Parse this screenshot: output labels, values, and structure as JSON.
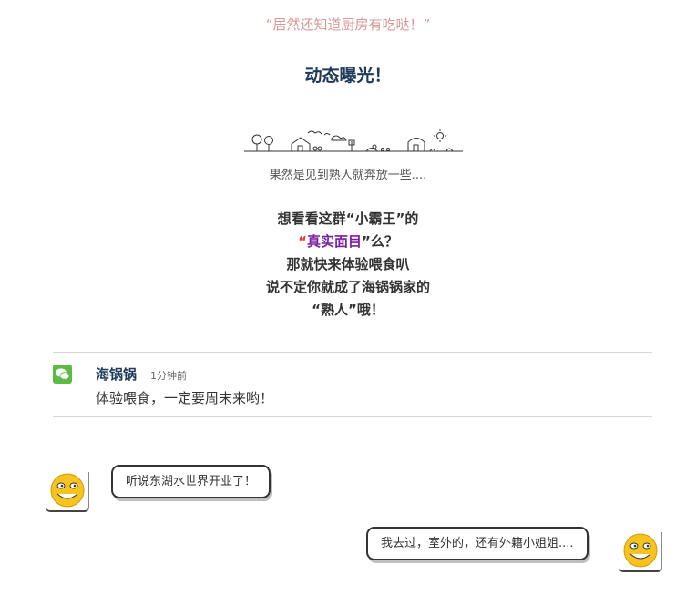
{
  "header": {
    "quote": "“居然还知道厨房有吃哒！”",
    "section_title": "动态曝光！"
  },
  "scene": {
    "caption": "果然是见到熟人就奔放一些...."
  },
  "blurb": {
    "line1": "想看看这群“小霸王”的",
    "line2_open": "“",
    "line2_highlight": "真实面目",
    "line2_rest": "”么？",
    "line3": "那就快来体验喂食叭",
    "line4": "说不定你就成了海锅锅家的",
    "line5": "“熟人”哦！"
  },
  "comment": {
    "icon": "wechat-icon",
    "user": "海锅锅",
    "time": "1分钟前",
    "text": "体验喂食，一定要周末来哟！"
  },
  "chat": {
    "left_message": "听说东湖水世界开业了！",
    "right_message": "我去过，室外的，还有外籍小姐姐....",
    "avatar_icon": "grinning-emoji-icon"
  }
}
